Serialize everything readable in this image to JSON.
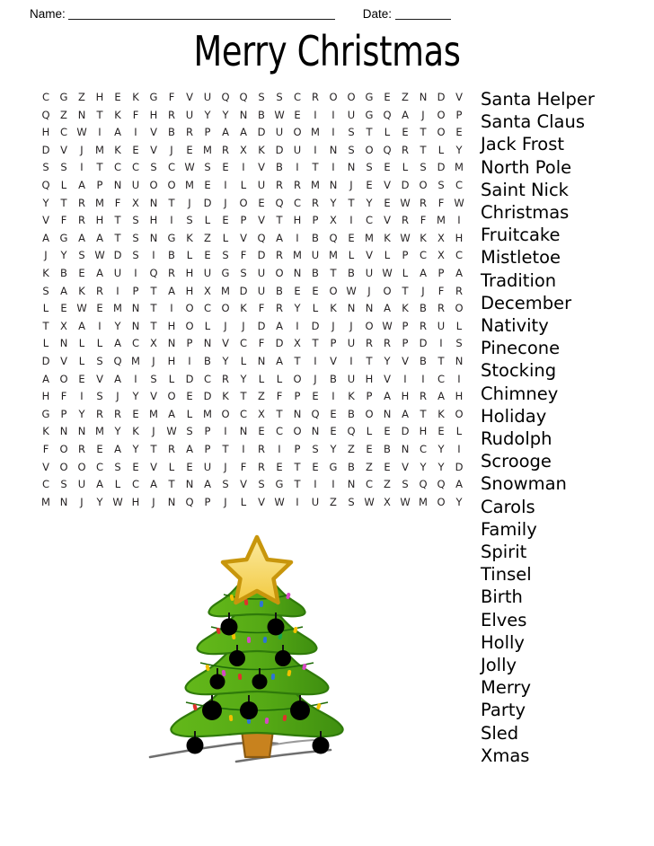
{
  "header": {
    "name_label": "Name:",
    "date_label": "Date:"
  },
  "title": "Merry Christmas",
  "puzzle": {
    "rows": 24,
    "cols": 24,
    "grid": [
      [
        "C",
        "G",
        "Z",
        "H",
        "E",
        "K",
        "G",
        "F",
        "V",
        "U",
        "Q",
        "Q",
        "S",
        "S",
        "C",
        "R",
        "O",
        "O",
        "G",
        "E",
        "Z",
        "N",
        "D",
        "V"
      ],
      [
        "Q",
        "Z",
        "N",
        "T",
        "K",
        "F",
        "H",
        "R",
        "U",
        "Y",
        "Y",
        "N",
        "B",
        "W",
        "E",
        "I",
        "I",
        "U",
        "G",
        "Q",
        "A",
        "J",
        "O",
        "P"
      ],
      [
        "H",
        "C",
        "W",
        "I",
        "A",
        "I",
        "V",
        "B",
        "R",
        "P",
        "A",
        "A",
        "D",
        "U",
        "O",
        "M",
        "I",
        "S",
        "T",
        "L",
        "E",
        "T",
        "O",
        "E"
      ],
      [
        "D",
        "V",
        "J",
        "M",
        "K",
        "E",
        "V",
        "J",
        "E",
        "M",
        "R",
        "X",
        "K",
        "D",
        "U",
        "I",
        "N",
        "S",
        "O",
        "Q",
        "R",
        "T",
        "L",
        "Y"
      ],
      [
        "S",
        "S",
        "I",
        "T",
        "C",
        "C",
        "S",
        "C",
        "W",
        "S",
        "E",
        "I",
        "V",
        "B",
        "I",
        "T",
        "I",
        "N",
        "S",
        "E",
        "L",
        "S",
        "D",
        "M"
      ],
      [
        "Q",
        "L",
        "A",
        "P",
        "N",
        "U",
        "O",
        "O",
        "M",
        "E",
        "I",
        "L",
        "U",
        "R",
        "R",
        "M",
        "N",
        "J",
        "E",
        "V",
        "D",
        "O",
        "S",
        "C"
      ],
      [
        "Y",
        "T",
        "R",
        "M",
        "F",
        "X",
        "N",
        "T",
        "J",
        "D",
        "J",
        "O",
        "E",
        "Q",
        "C",
        "R",
        "Y",
        "T",
        "Y",
        "E",
        "W",
        "R",
        "F",
        "W"
      ],
      [
        "V",
        "F",
        "R",
        "H",
        "T",
        "S",
        "H",
        "I",
        "S",
        "L",
        "E",
        "P",
        "V",
        "T",
        "H",
        "P",
        "X",
        "I",
        "C",
        "V",
        "R",
        "F",
        "M",
        "I"
      ],
      [
        "A",
        "G",
        "A",
        "A",
        "T",
        "S",
        "N",
        "G",
        "K",
        "Z",
        "L",
        "V",
        "Q",
        "A",
        "I",
        "B",
        "Q",
        "E",
        "M",
        "K",
        "W",
        "K",
        "X",
        "H"
      ],
      [
        "J",
        "Y",
        "S",
        "W",
        "D",
        "S",
        "I",
        "B",
        "L",
        "E",
        "S",
        "F",
        "D",
        "R",
        "M",
        "U",
        "M",
        "L",
        "V",
        "L",
        "P",
        "C",
        "X",
        "C"
      ],
      [
        "K",
        "B",
        "E",
        "A",
        "U",
        "I",
        "Q",
        "R",
        "H",
        "U",
        "G",
        "S",
        "U",
        "O",
        "N",
        "B",
        "T",
        "B",
        "U",
        "W",
        "L",
        "A",
        "P",
        "A"
      ],
      [
        "S",
        "A",
        "K",
        "R",
        "I",
        "P",
        "T",
        "A",
        "H",
        "X",
        "M",
        "D",
        "U",
        "B",
        "E",
        "E",
        "O",
        "W",
        "J",
        "O",
        "T",
        "J",
        "F",
        "R"
      ],
      [
        "L",
        "E",
        "W",
        "E",
        "M",
        "N",
        "T",
        "I",
        "O",
        "C",
        "O",
        "K",
        "F",
        "R",
        "Y",
        "L",
        "K",
        "N",
        "N",
        "A",
        "K",
        "B",
        "R",
        "O"
      ],
      [
        "T",
        "X",
        "A",
        "I",
        "Y",
        "N",
        "T",
        "H",
        "O",
        "L",
        "J",
        "J",
        "D",
        "A",
        "I",
        "D",
        "J",
        "J",
        "O",
        "W",
        "P",
        "R",
        "U",
        "L"
      ],
      [
        "L",
        "N",
        "L",
        "L",
        "A",
        "C",
        "X",
        "N",
        "P",
        "N",
        "V",
        "C",
        "F",
        "D",
        "X",
        "T",
        "P",
        "U",
        "R",
        "R",
        "P",
        "D",
        "I",
        "S"
      ],
      [
        "D",
        "V",
        "L",
        "S",
        "Q",
        "M",
        "J",
        "H",
        "I",
        "B",
        "Y",
        "L",
        "N",
        "A",
        "T",
        "I",
        "V",
        "I",
        "T",
        "Y",
        "V",
        "B",
        "T",
        "N"
      ],
      [
        "A",
        "O",
        "E",
        "V",
        "A",
        "I",
        "S",
        "L",
        "D",
        "C",
        "R",
        "Y",
        "L",
        "L",
        "O",
        "J",
        "B",
        "U",
        "H",
        "V",
        "I",
        "I",
        "C",
        "I"
      ],
      [
        "H",
        "F",
        "I",
        "S",
        "J",
        "Y",
        "V",
        "O",
        "E",
        "D",
        "K",
        "T",
        "Z",
        "F",
        "P",
        "E",
        "I",
        "K",
        "P",
        "A",
        "H",
        "R",
        "A",
        "H"
      ],
      [
        "G",
        "P",
        "Y",
        "R",
        "R",
        "E",
        "M",
        "A",
        "L",
        "M",
        "O",
        "C",
        "X",
        "T",
        "N",
        "Q",
        "E",
        "B",
        "O",
        "N",
        "A",
        "T",
        "K",
        "O"
      ],
      [
        "K",
        "N",
        "N",
        "M",
        "Y",
        "K",
        "J",
        "W",
        "S",
        "P",
        "I",
        "N",
        "E",
        "C",
        "O",
        "N",
        "E",
        "Q",
        "L",
        "E",
        "D",
        "H",
        "E",
        "L"
      ],
      [
        "F",
        "O",
        "R",
        "E",
        "A",
        "Y",
        "T",
        "R",
        "A",
        "P",
        "T",
        "I",
        "R",
        "I",
        "P",
        "S",
        "Y",
        "Z",
        "E",
        "B",
        "N",
        "C",
        "Y",
        "I"
      ],
      [
        "V",
        "O",
        "O",
        "C",
        "S",
        "E",
        "V",
        "L",
        "E",
        "U",
        "J",
        "F",
        "R",
        "E",
        "T",
        "E",
        "G",
        "B",
        "Z",
        "E",
        "V",
        "Y",
        "Y",
        "D"
      ],
      [
        "C",
        "S",
        "U",
        "A",
        "L",
        "C",
        "A",
        "T",
        "N",
        "A",
        "S",
        "V",
        "S",
        "G",
        "T",
        "I",
        "I",
        "N",
        "C",
        "Z",
        "S",
        "Q",
        "Q",
        "A"
      ],
      [
        "M",
        "N",
        "J",
        "Y",
        "W",
        "H",
        "J",
        "N",
        "Q",
        "P",
        "J",
        "L",
        "V",
        "W",
        "I",
        "U",
        "Z",
        "S",
        "W",
        "X",
        "W",
        "M",
        "O",
        "Y"
      ]
    ]
  },
  "wordlist": [
    "Santa Helper",
    "Santa Claus",
    "Jack Frost",
    "North Pole",
    "Saint Nick",
    "Christmas",
    "Fruitcake",
    "Mistletoe",
    "Tradition",
    "December",
    "Nativity",
    "Pinecone",
    "Stocking",
    "Chimney",
    "Holiday",
    "Rudolph",
    "Scrooge",
    "Snowman",
    "Carols",
    "Family",
    "Spirit",
    "Tinsel",
    "Birth",
    "Elves",
    "Holly",
    "Jolly",
    "Merry",
    "Party",
    "Sled",
    "Xmas"
  ],
  "illustration": {
    "name": "christmas-tree",
    "star_fill": "#f7dc6f",
    "star_stroke": "#c8960c",
    "foliage_dark": "#4f9c16",
    "foliage_mid": "#5fb317",
    "foliage_light": "#72c41f",
    "trunk_fill": "#c8821e",
    "trunk_stroke": "#8a5a12",
    "ornament_fill": "#000000",
    "ground_stroke": "#6b6b6b"
  }
}
